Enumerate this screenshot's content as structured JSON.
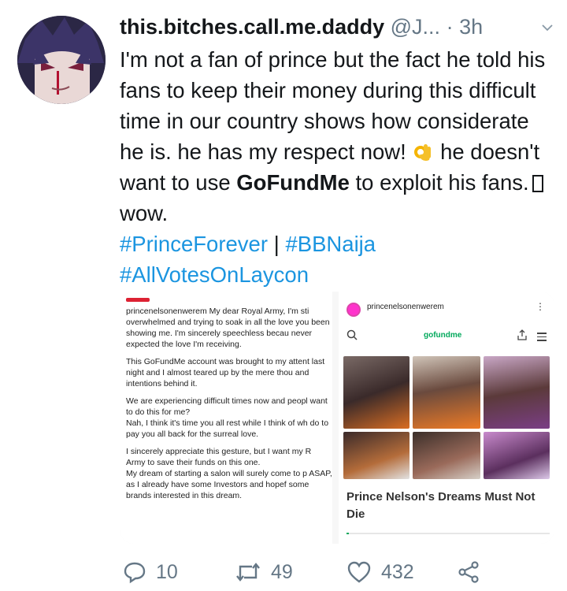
{
  "user": {
    "display_name": "this.bitches.call.me.daddy",
    "handle": "@J...",
    "dot": "·",
    "time": "3h"
  },
  "tweet": {
    "part1": "I'm not a fan of prince but the fact he told his fans to keep their money during this difficult time in our country shows how considerate he is. he has my respect now!",
    "emoji_icon": "ok-hand-icon",
    "part2": "he doesn't want to use",
    "bold_word": "GoFundMe",
    "part3": "to exploit his fans.",
    "part4": "wow.",
    "hashtag1": "#PrinceForever",
    "separator": "|",
    "hashtag2": "#BBNaija",
    "hashtag3": "#AllVotesOnLaycon"
  },
  "media": {
    "left_paragraphs": [
      "princenelsonenwerem My dear Royal Army, I'm sti overwhelmed and trying to soak in all the love you been showing me. I'm sincerely speechless becau never expected the love I'm receiving.",
      "This GoFundMe account was brought to my attent last night and I almost teared up by the mere thou and intentions behind it.",
      "We are experiencing difficult times now and peopl want to do this for me?\nNah, I think it's time you all rest while I think of wh do to pay you all back for the surreal love.",
      "I sincerely appreciate this gesture, but I want my R Army to save their funds on this one.\nMy dream of starting a salon will surely come to p ASAP, as I already have some Investors and hopef some brands interested in this dream."
    ],
    "ig_username": "princenelsonenwerem",
    "ig_more": "⋮",
    "gf_logo": "gofundme",
    "campaign_title": "Prince Nelson's Dreams Must Not Die",
    "progress": 0.01
  },
  "actions": {
    "reply_count": "10",
    "retweet_count": "49",
    "like_count": "432"
  },
  "colors": {
    "link": "#1b95e0",
    "muted": "#657786",
    "gofundme_green": "#02a95c"
  }
}
